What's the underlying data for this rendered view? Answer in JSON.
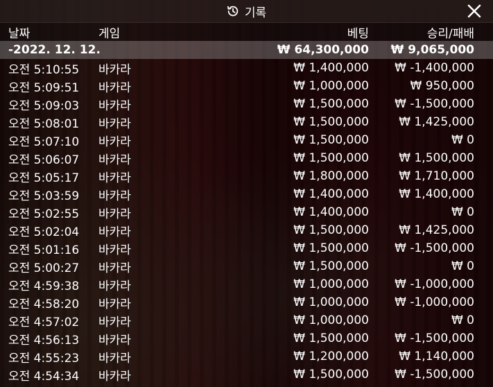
{
  "window": {
    "title": "기록",
    "title_icon": "history-icon",
    "close_icon": "close-icon"
  },
  "columns": {
    "date": "날짜",
    "game": "게임",
    "bet": "베팅",
    "result": "승리/패배"
  },
  "summary": {
    "date": "-2022. 12. 12.",
    "bet": "₩ 64,300,000",
    "result": "₩ 9,065,000"
  },
  "rows": [
    {
      "time": "오전 5:10:55",
      "game": "바카라",
      "bet": "₩ 1,400,000",
      "result": "₩ -1,400,000"
    },
    {
      "time": "오전 5:09:51",
      "game": "바카라",
      "bet": "₩ 1,000,000",
      "result": "₩ 950,000"
    },
    {
      "time": "오전 5:09:03",
      "game": "바카라",
      "bet": "₩ 1,500,000",
      "result": "₩ -1,500,000"
    },
    {
      "time": "오전 5:08:01",
      "game": "바카라",
      "bet": "₩ 1,500,000",
      "result": "₩ 1,425,000"
    },
    {
      "time": "오전 5:07:10",
      "game": "바카라",
      "bet": "₩ 1,500,000",
      "result": "₩ 0"
    },
    {
      "time": "오전 5:06:07",
      "game": "바카라",
      "bet": "₩ 1,500,000",
      "result": "₩ 1,500,000"
    },
    {
      "time": "오전 5:05:17",
      "game": "바카라",
      "bet": "₩ 1,800,000",
      "result": "₩ 1,710,000"
    },
    {
      "time": "오전 5:03:59",
      "game": "바카라",
      "bet": "₩ 1,400,000",
      "result": "₩ 1,400,000"
    },
    {
      "time": "오전 5:02:55",
      "game": "바카라",
      "bet": "₩ 1,400,000",
      "result": "₩ 0"
    },
    {
      "time": "오전 5:02:04",
      "game": "바카라",
      "bet": "₩ 1,500,000",
      "result": "₩ 1,425,000"
    },
    {
      "time": "오전 5:01:16",
      "game": "바카라",
      "bet": "₩ 1,500,000",
      "result": "₩ -1,500,000"
    },
    {
      "time": "오전 5:00:27",
      "game": "바카라",
      "bet": "₩ 1,500,000",
      "result": "₩ 0"
    },
    {
      "time": "오전 4:59:38",
      "game": "바카라",
      "bet": "₩ 1,000,000",
      "result": "₩ -1,000,000"
    },
    {
      "time": "오전 4:58:20",
      "game": "바카라",
      "bet": "₩ 1,000,000",
      "result": "₩ -1,000,000"
    },
    {
      "time": "오전 4:57:02",
      "game": "바카라",
      "bet": "₩ 1,000,000",
      "result": "₩ 0"
    },
    {
      "time": "오전 4:56:13",
      "game": "바카라",
      "bet": "₩ 1,500,000",
      "result": "₩ -1,500,000"
    },
    {
      "time": "오전 4:55:23",
      "game": "바카라",
      "bet": "₩ 1,200,000",
      "result": "₩ 1,140,000"
    },
    {
      "time": "오전 4:54:34",
      "game": "바카라",
      "bet": "₩ 1,500,000",
      "result": "₩ -1,500,000"
    }
  ]
}
